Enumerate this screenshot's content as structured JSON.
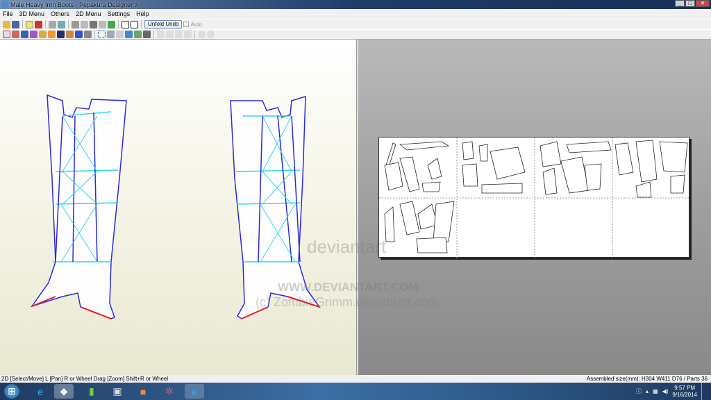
{
  "window": {
    "title": "Male Heavy Iron Boots - Pepakura Designer 3"
  },
  "menu": [
    "File",
    "3D Menu",
    "Others",
    "2D Menu",
    "Settings",
    "Help"
  ],
  "toolbar": {
    "unfold_undo": "Unfold Undo",
    "auto": "Auto"
  },
  "watermark": {
    "site": "WWW.DEVIANTART.COM",
    "credit": "(c) ZombieGrimm.deviantart.com",
    "logo": "deviantart"
  },
  "status": {
    "left": "2D [Select/Move] L [Pan] R or Wheel Drag [Zoom] Shift+R or Wheel",
    "right": "Assembled size(mm): H304 W411 D76 / Parts 36"
  },
  "taskbar": {
    "time": "9:57 PM",
    "date": "9/16/2014"
  },
  "colors": {
    "edge": "#2a2adf",
    "fold": "#33d6e6",
    "cut": "#e02020"
  }
}
